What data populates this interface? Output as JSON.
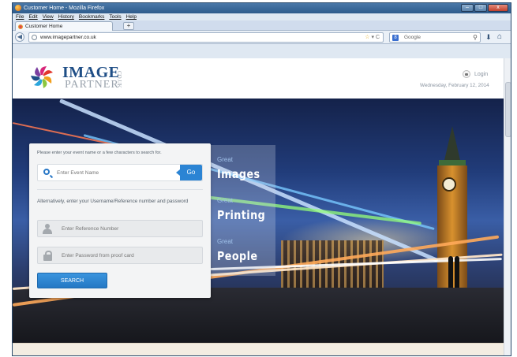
{
  "window": {
    "title": "Customer Home - Mozilla Firefox",
    "controls": [
      "–",
      "□",
      "x"
    ]
  },
  "menu": [
    "File",
    "Edit",
    "View",
    "History",
    "Bookmarks",
    "Tools",
    "Help"
  ],
  "tabs": [
    {
      "label": "Customer Home"
    }
  ],
  "newtab_label": "+",
  "nav": {
    "url": "www.imagepartner.co.uk",
    "search_placeholder": "Google",
    "url_actions": "☆ ▾ C"
  },
  "site": {
    "logo": {
      "line1": "IMAGE",
      "line2": "PARTNER",
      "suffix": "CO.UK"
    },
    "login_label": "Login",
    "date": "Wednesday, February 12, 2014"
  },
  "search": {
    "event_prompt": "Please enter your event name or a few characters to search for.",
    "event_placeholder": "Enter Event Name",
    "go_label": "Go",
    "alt_prompt": "Alternatively, enter your Username/Reference number and password",
    "ref_placeholder": "Enter Reference Number",
    "password_placeholder": "Enter Password from proof card",
    "search_label": "SEARCH"
  },
  "taglines": [
    {
      "small": "Great",
      "big": "Images"
    },
    {
      "small": "Great",
      "big": "Printing"
    },
    {
      "small": "Great",
      "big": "People"
    }
  ],
  "colors": {
    "brand_blue": "#1f4e86",
    "button_blue": "#2b84d4"
  }
}
